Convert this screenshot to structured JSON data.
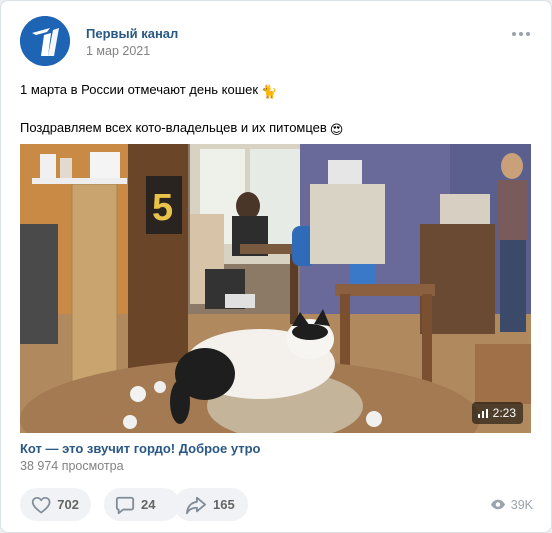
{
  "post": {
    "author": "Первый канал",
    "date": "1 мар 2021",
    "text_line1": "1 марта в России отмечают день кошек",
    "text_line2": "Поздравляем всех кото-владельцев и их питомцев",
    "emoji1": "🐈",
    "emoji2": "😍"
  },
  "video": {
    "duration": "2:23",
    "title": "Кот — это звучит гордо! Доброе утро",
    "views": "38 974 просмотра",
    "sign_digit": "5"
  },
  "actions": {
    "likes": "702",
    "comments": "24",
    "shares": "165",
    "views": "39K"
  },
  "icons": {
    "more": "more-horizontal-icon",
    "like": "heart-icon",
    "comment": "comment-icon",
    "share": "share-icon",
    "views": "eye-icon",
    "duration": "signal-bars-icon"
  },
  "colors": {
    "link": "#2a5885",
    "secondary": "#828282",
    "button_bg": "#f0f2f5",
    "icon": "#99a2ad",
    "logo_bg": "#1e64b4"
  }
}
